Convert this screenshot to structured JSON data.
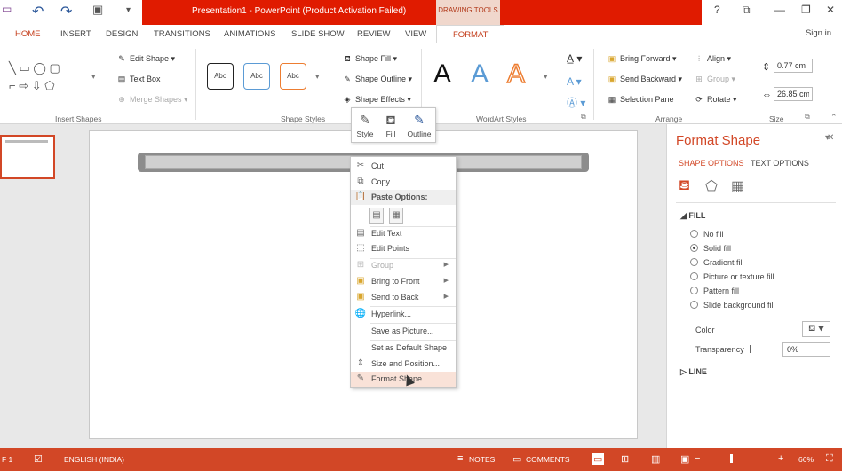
{
  "titlebar": {
    "title": "Presentation1 -  PowerPoint (Product Activation Failed)",
    "context_tab_group": "DRAWING TOOLS",
    "window_controls": [
      "?",
      "ribbon-display-icon",
      "minimize-icon",
      "restore-icon",
      "close-icon"
    ]
  },
  "tabs": [
    "HOME",
    "INSERT",
    "DESIGN",
    "TRANSITIONS",
    "ANIMATIONS",
    "SLIDE SHOW",
    "REVIEW",
    "VIEW",
    "FORMAT"
  ],
  "active_tab": "FORMAT",
  "sign_in": "Sign in",
  "ribbon": {
    "insert_shapes": {
      "label": "Insert Shapes",
      "edit_shape": "Edit Shape",
      "text_box": "Text Box",
      "merge_shapes": "Merge Shapes"
    },
    "shape_styles": {
      "label": "Shape Styles",
      "preset": "Abc",
      "fill": "Shape Fill",
      "outline": "Shape Outline",
      "effects": "Shape Effects"
    },
    "wordart": {
      "label": "WordArt Styles",
      "letter": "A"
    },
    "arrange": {
      "label": "Arrange",
      "bring_forward": "Bring Forward",
      "send_backward": "Send Backward",
      "selection_pane": "Selection Pane",
      "align": "Align",
      "group": "Group",
      "rotate": "Rotate"
    },
    "size": {
      "label": "Size",
      "height": "0.77 cm",
      "width": "26.85 cm"
    }
  },
  "mini_toolbar": {
    "style": "Style",
    "fill": "Fill",
    "outline": "Outline"
  },
  "context_menu": {
    "cut": "Cut",
    "copy": "Copy",
    "paste_options": "Paste Options:",
    "edit_text": "Edit Text",
    "edit_points": "Edit Points",
    "group": "Group",
    "bring_to_front": "Bring to Front",
    "send_to_back": "Send to Back",
    "hyperlink": "Hyperlink...",
    "save_as_picture": "Save as Picture...",
    "set_default_shape": "Set as Default Shape",
    "size_and_position": "Size and Position...",
    "format_shape": "Format Shape..."
  },
  "format_pane": {
    "title": "Format Shape",
    "tab_shape_options": "SHAPE OPTIONS",
    "tab_text_options": "TEXT OPTIONS",
    "fill_section": "FILL",
    "fill_options": [
      "No fill",
      "Solid fill",
      "Gradient fill",
      "Picture or texture fill",
      "Pattern fill",
      "Slide background fill"
    ],
    "selected_fill": "Solid fill",
    "color_label": "Color",
    "transparency_label": "Transparency",
    "transparency_value": "0%",
    "line_section": "LINE"
  },
  "statusbar": {
    "slide": "F 1",
    "language": "ENGLISH (INDIA)",
    "notes": "NOTES",
    "comments": "COMMENTS",
    "zoom": "66%"
  },
  "colors": {
    "accent": "#d24726",
    "title_red": "#e01b00"
  }
}
